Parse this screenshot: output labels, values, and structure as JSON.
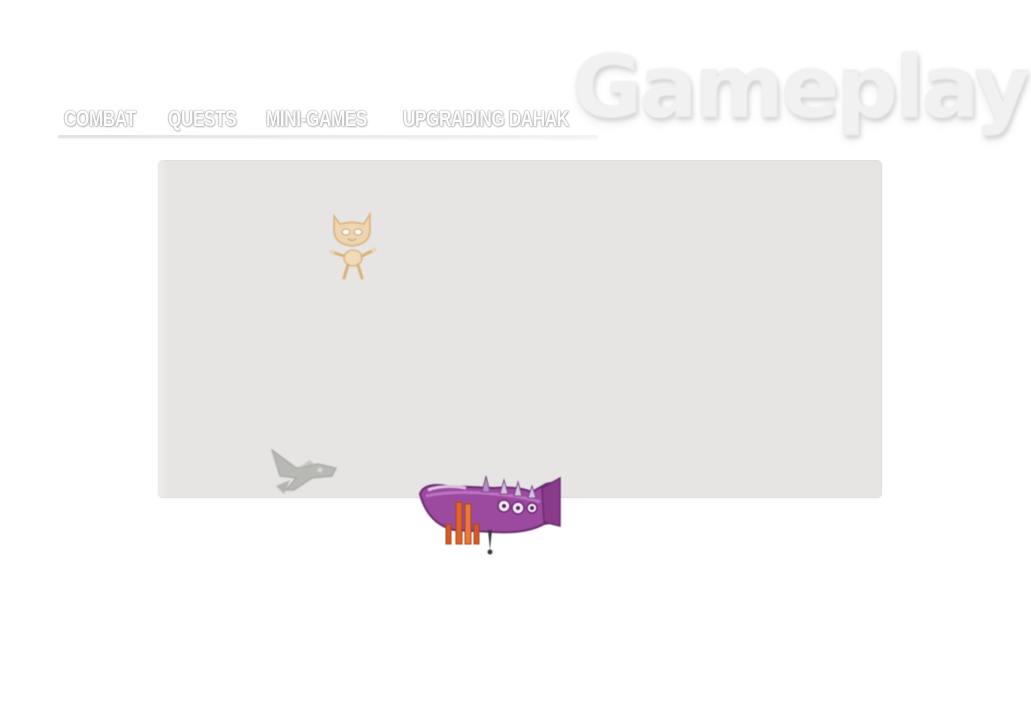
{
  "title": "Gameplay",
  "nav": {
    "items": [
      {
        "label": "COMBAT"
      },
      {
        "label": "QUESTS"
      },
      {
        "label": "MINI-GAMES"
      },
      {
        "label": "UPGRADING DAHAK"
      }
    ]
  },
  "viewport": {
    "sprites": [
      {
        "icon": "cat-creature-icon"
      },
      {
        "icon": "fighter-plane-icon"
      },
      {
        "icon": "purple-airship-icon"
      }
    ]
  },
  "colors": {
    "panel_background": "#e6e5e3",
    "ship_purple": "#8a3a8a",
    "ship_orange": "#e0642a",
    "cat_tan": "#e8c48a"
  }
}
